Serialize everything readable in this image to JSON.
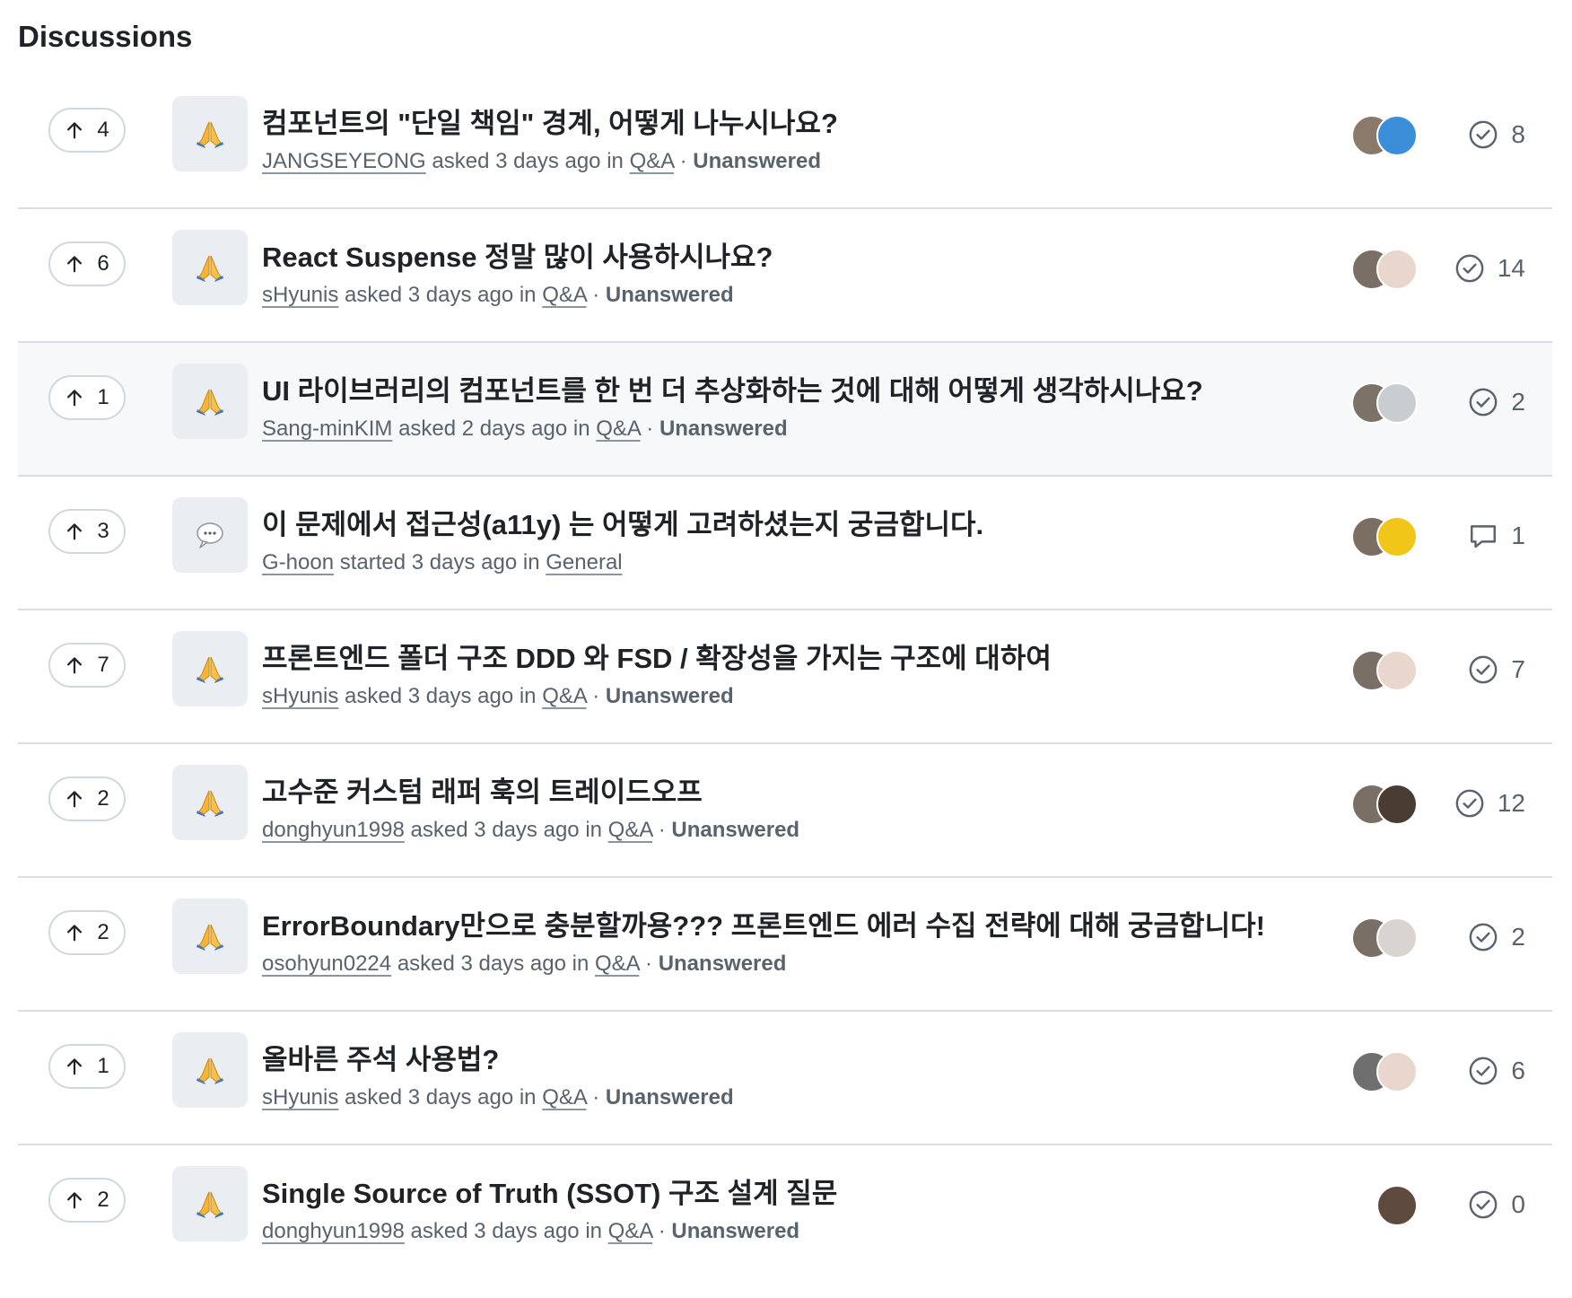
{
  "header": {
    "title": "Discussions"
  },
  "colors": {
    "text_primary": "#1f2328",
    "text_muted": "#59636e",
    "border": "#d0d7de",
    "row_hover": "#f6f8fa",
    "category_tile": "#eaeef2"
  },
  "discussions": [
    {
      "upvotes": "4",
      "category_icon": "praying-hands-icon",
      "title": "컴포넌트의 \"단일 책임\" 경계, 어떻게 나누시나요?",
      "author": "JANGSEYEONG",
      "verb": "asked",
      "time": "3 days ago",
      "in": "in",
      "category": "Q&A",
      "separator": "·",
      "status": "Unanswered",
      "status_icon": "answered-check-icon",
      "comment_count": "8",
      "avatars": [
        "#8a7a6a",
        "#3b8fd9"
      ]
    },
    {
      "upvotes": "6",
      "category_icon": "praying-hands-icon",
      "title": "React Suspense 정말 많이 사용하시나요?",
      "author": "sHyunis",
      "verb": "asked",
      "time": "3 days ago",
      "in": "in",
      "category": "Q&A",
      "separator": "·",
      "status": "Unanswered",
      "status_icon": "answered-check-icon",
      "comment_count": "14",
      "avatars": [
        "#7a6f65",
        "#e9d6cd"
      ]
    },
    {
      "upvotes": "1",
      "category_icon": "praying-hands-icon",
      "title": "UI 라이브러리의 컴포넌트를 한 번 더 추상화하는 것에 대해 어떻게 생각하시나요?",
      "author": "Sang-minKIM",
      "verb": "asked",
      "time": "2 days ago",
      "in": "in",
      "category": "Q&A",
      "separator": "·",
      "status": "Unanswered",
      "status_icon": "answered-check-icon",
      "comment_count": "2",
      "avatars": [
        "#7d7266",
        "#c9ccd1"
      ]
    },
    {
      "upvotes": "3",
      "category_icon": "speech-balloon-icon",
      "title": "이 문제에서 접근성(a11y) 는 어떻게 고려하셨는지 궁금합니다.",
      "author": "G-hoon",
      "verb": "started",
      "time": "3 days ago",
      "in": "in",
      "category": "General",
      "separator": "",
      "status": "",
      "status_icon": "comment-bubble-icon",
      "comment_count": "1",
      "avatars": [
        "#7b6e62",
        "#f2c618"
      ]
    },
    {
      "upvotes": "7",
      "category_icon": "praying-hands-icon",
      "title": "프론트엔드 폴더 구조 DDD 와 FSD / 확장성을 가지는 구조에 대하여",
      "author": "sHyunis",
      "verb": "asked",
      "time": "3 days ago",
      "in": "in",
      "category": "Q&A",
      "separator": "·",
      "status": "Unanswered",
      "status_icon": "answered-check-icon",
      "comment_count": "7",
      "avatars": [
        "#7a6f65",
        "#e9d6cd"
      ]
    },
    {
      "upvotes": "2",
      "category_icon": "praying-hands-icon",
      "title": "고수준 커스텀 래퍼 훅의 트레이드오프",
      "author": "donghyun1998",
      "verb": "asked",
      "time": "3 days ago",
      "in": "in",
      "category": "Q&A",
      "separator": "·",
      "status": "Unanswered",
      "status_icon": "answered-check-icon",
      "comment_count": "12",
      "avatars": [
        "#7a6f65",
        "#4a3b33"
      ]
    },
    {
      "upvotes": "2",
      "category_icon": "praying-hands-icon",
      "title": "ErrorBoundary만으로 충분할까용??? 프론트엔드 에러 수집 전략에 대해 궁금합니다!",
      "author": "osohyun0224",
      "verb": "asked",
      "time": "3 days ago",
      "in": "in",
      "category": "Q&A",
      "separator": "·",
      "status": "Unanswered",
      "status_icon": "answered-check-icon",
      "comment_count": "2",
      "avatars": [
        "#7a6f65",
        "#d9d4d0"
      ]
    },
    {
      "upvotes": "1",
      "category_icon": "praying-hands-icon",
      "title": "올바른 주석 사용법?",
      "author": "sHyunis",
      "verb": "asked",
      "time": "3 days ago",
      "in": "in",
      "category": "Q&A",
      "separator": "·",
      "status": "Unanswered",
      "status_icon": "answered-check-icon",
      "comment_count": "6",
      "avatars": [
        "#6f6f70",
        "#e9d6cd"
      ]
    },
    {
      "upvotes": "2",
      "category_icon": "praying-hands-icon",
      "title": "Single Source of Truth (SSOT) 구조 설계 질문",
      "author": "donghyun1998",
      "verb": "asked",
      "time": "3 days ago",
      "in": "in",
      "category": "Q&A",
      "separator": "·",
      "status": "Unanswered",
      "status_icon": "answered-check-icon",
      "comment_count": "0",
      "avatars": [
        "#5e4a3e"
      ]
    }
  ]
}
